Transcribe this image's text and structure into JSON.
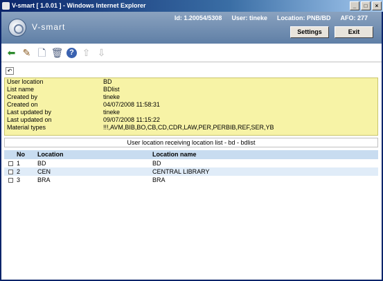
{
  "window": {
    "title": "V-smart [ 1.0.01 ] - Windows Internet Explorer",
    "min": "_",
    "max": "□",
    "close": "×"
  },
  "header": {
    "logo_text": "V-smart",
    "id": "Id: 1.20054/5308",
    "user": "User: tineke",
    "location": "Location: PNB/BD",
    "afo": "AFO: 277",
    "settings_label": "Settings",
    "exit_label": "Exit"
  },
  "toolbar": {
    "back": "⬅",
    "edit": "✎",
    "new": "🗋",
    "delete": "🗑",
    "help": "?",
    "up": "⇧",
    "down": "⇩",
    "undo": "↶"
  },
  "details": [
    {
      "label": "User location",
      "value": "BD"
    },
    {
      "label": "List name",
      "value": "BDlist"
    },
    {
      "label": "Created by",
      "value": "tineke"
    },
    {
      "label": "Created on",
      "value": "04/07/2008 11:58:31"
    },
    {
      "label": "Last updated by",
      "value": "tineke"
    },
    {
      "label": "Last updated on",
      "value": "09/07/2008 11:15:22"
    },
    {
      "label": "Material types",
      "value": "!!!,AVM,BIB,BO,CB,CD,CDR,LAW,PER,PERBIB,REF,SER,YB"
    }
  ],
  "caption": "User location receiving location list - bd - bdlist",
  "table": {
    "headers": {
      "no": "No",
      "location": "Location",
      "location_name": "Location name"
    },
    "rows": [
      {
        "no": "1",
        "location": "BD",
        "location_name": "BD"
      },
      {
        "no": "2",
        "location": "CEN",
        "location_name": "CENTRAL LIBRARY"
      },
      {
        "no": "3",
        "location": "BRA",
        "location_name": "BRA"
      }
    ]
  }
}
